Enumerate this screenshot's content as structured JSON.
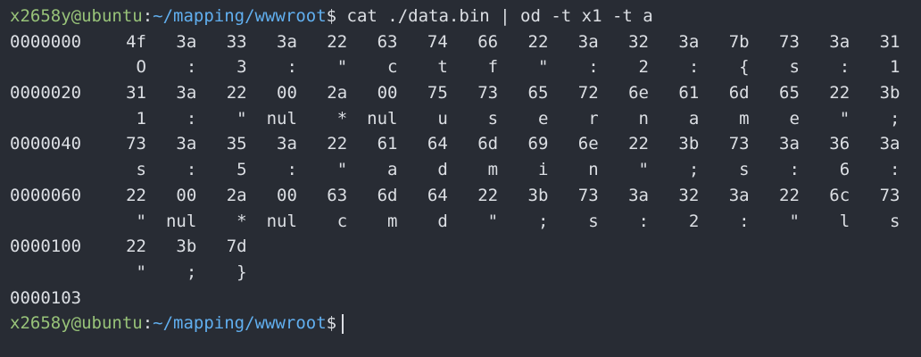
{
  "colors": {
    "background": "#282c34",
    "prompt_user": "#98c379",
    "prompt_path": "#61afef",
    "text": "#dcdfe4"
  },
  "prompt": {
    "user_host": "x2658y@ubuntu",
    "separator": ":",
    "path": "~/mapping/wwwroot",
    "symbol": "$"
  },
  "command": "cat ./data.bin | od -t x1 -t a",
  "dump": [
    {
      "offset": "0000000",
      "hex": [
        "4f",
        "3a",
        "33",
        "3a",
        "22",
        "63",
        "74",
        "66",
        "22",
        "3a",
        "32",
        "3a",
        "7b",
        "73",
        "3a",
        "31"
      ],
      "ascii": [
        "O",
        ":",
        "3",
        ":",
        "\"",
        "c",
        "t",
        "f",
        "\"",
        ":",
        "2",
        ":",
        "{",
        "s",
        ":",
        "1"
      ]
    },
    {
      "offset": "0000020",
      "hex": [
        "31",
        "3a",
        "22",
        "00",
        "2a",
        "00",
        "75",
        "73",
        "65",
        "72",
        "6e",
        "61",
        "6d",
        "65",
        "22",
        "3b"
      ],
      "ascii": [
        "1",
        ":",
        "\"",
        "nul",
        "*",
        "nul",
        "u",
        "s",
        "e",
        "r",
        "n",
        "a",
        "m",
        "e",
        "\"",
        ";"
      ]
    },
    {
      "offset": "0000040",
      "hex": [
        "73",
        "3a",
        "35",
        "3a",
        "22",
        "61",
        "64",
        "6d",
        "69",
        "6e",
        "22",
        "3b",
        "73",
        "3a",
        "36",
        "3a"
      ],
      "ascii": [
        "s",
        ":",
        "5",
        ":",
        "\"",
        "a",
        "d",
        "m",
        "i",
        "n",
        "\"",
        ";",
        "s",
        ":",
        "6",
        ":"
      ]
    },
    {
      "offset": "0000060",
      "hex": [
        "22",
        "00",
        "2a",
        "00",
        "63",
        "6d",
        "64",
        "22",
        "3b",
        "73",
        "3a",
        "32",
        "3a",
        "22",
        "6c",
        "73"
      ],
      "ascii": [
        "\"",
        "nul",
        "*",
        "nul",
        "c",
        "m",
        "d",
        "\"",
        ";",
        "s",
        ":",
        "2",
        ":",
        "\"",
        "l",
        "s"
      ]
    },
    {
      "offset": "0000100",
      "hex": [
        "22",
        "3b",
        "7d"
      ],
      "ascii": [
        "\"",
        ";",
        "}"
      ]
    }
  ],
  "end_offset": "0000103"
}
